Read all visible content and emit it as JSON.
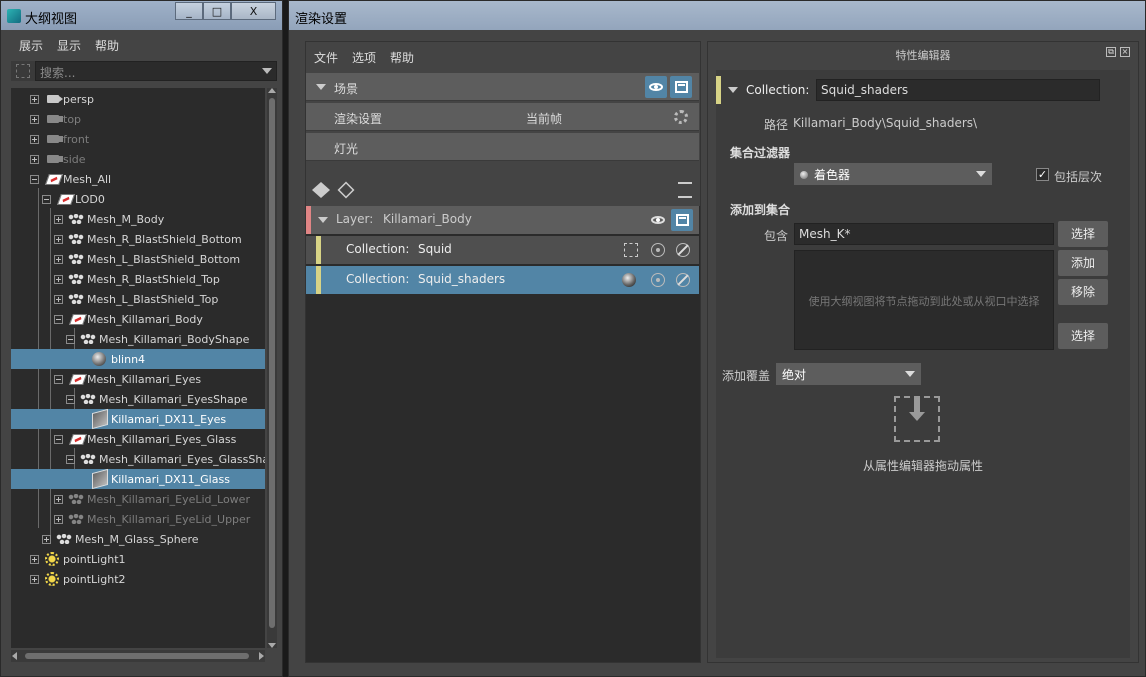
{
  "outliner": {
    "title": "大纲视图",
    "window_buttons": [
      "_",
      "□",
      "X"
    ],
    "menu": [
      "展示",
      "显示",
      "帮助"
    ],
    "search_placeholder": "搜索...",
    "rows": [
      {
        "label": "persp",
        "icon": "camera-icon",
        "dim": false
      },
      {
        "label": "top",
        "icon": "camera-icon",
        "dim": true
      },
      {
        "label": "front",
        "icon": "camera-icon",
        "dim": true
      },
      {
        "label": "side",
        "icon": "camera-icon",
        "dim": true
      },
      {
        "label": "Mesh_All",
        "icon": "group-icon",
        "dim": false
      },
      {
        "label": "LOD0",
        "icon": "group-icon",
        "dim": false
      },
      {
        "label": "Mesh_M_Body",
        "icon": "mesh-icon",
        "dim": false
      },
      {
        "label": "Mesh_R_BlastShield_Bottom",
        "icon": "mesh-icon",
        "dim": false
      },
      {
        "label": "Mesh_L_BlastShield_Bottom",
        "icon": "mesh-icon",
        "dim": false
      },
      {
        "label": "Mesh_R_BlastShield_Top",
        "icon": "mesh-icon",
        "dim": false
      },
      {
        "label": "Mesh_L_BlastShield_Top",
        "icon": "mesh-icon",
        "dim": false
      },
      {
        "label": "Mesh_Killamari_Body",
        "icon": "group-icon",
        "dim": false
      },
      {
        "label": "Mesh_Killamari_BodyShape",
        "icon": "mesh-icon",
        "dim": false
      },
      {
        "label": "blinn4",
        "icon": "material-ball-icon",
        "dim": false,
        "selected": true
      },
      {
        "label": "Mesh_Killamari_Eyes",
        "icon": "group-icon",
        "dim": false
      },
      {
        "label": "Mesh_Killamari_EyesShape",
        "icon": "mesh-icon",
        "dim": false
      },
      {
        "label": "Killamari_DX11_Eyes",
        "icon": "shading-group-icon",
        "dim": false,
        "selected": true
      },
      {
        "label": "Mesh_Killamari_Eyes_Glass",
        "icon": "group-icon",
        "dim": false
      },
      {
        "label": "Mesh_Killamari_Eyes_GlassShape",
        "icon": "mesh-icon",
        "dim": false
      },
      {
        "label": "Killamari_DX11_Glass",
        "icon": "shading-group-icon",
        "dim": false,
        "selected": true
      },
      {
        "label": "Mesh_Killamari_EyeLid_Lower",
        "icon": "mesh-icon",
        "dim": true
      },
      {
        "label": "Mesh_Killamari_EyeLid_Upper",
        "icon": "mesh-icon",
        "dim": true
      },
      {
        "label": "Mesh_M_Glass_Sphere",
        "icon": "mesh-icon",
        "dim": false
      },
      {
        "label": "pointLight1",
        "icon": "point-light-icon",
        "dim": false
      },
      {
        "label": "pointLight2",
        "icon": "point-light-icon",
        "dim": false
      }
    ]
  },
  "render_setup": {
    "title": "渲染设置",
    "menu": [
      "文件",
      "选项",
      "帮助"
    ],
    "scene_label": "场景",
    "render_settings_label": "渲染设置",
    "current_frame_label": "当前帧",
    "lights_label": "灯光",
    "layer_label": "Layer:",
    "layer_name": "Killamari_Body",
    "collections": [
      {
        "prefix": "Collection:",
        "name": "Squid",
        "selected": false
      },
      {
        "prefix": "Collection:",
        "name": "Squid_shaders",
        "selected": true
      }
    ]
  },
  "attribute_editor": {
    "title": "特性编辑器",
    "collection_label": "Collection:",
    "collection_name": "Squid_shaders",
    "path_label": "路径",
    "path_value": "Killamari_Body\\Squid_shaders\\",
    "filter_header": "集合过滤器",
    "filter_value": "着色器",
    "include_hierarchy_label": "包括层次",
    "include_hierarchy_checked": true,
    "add_to_collection_header": "添加到集合",
    "include_label": "包含",
    "include_value": "Mesh_K*",
    "select_button": "选择",
    "add_button": "添加",
    "remove_button": "移除",
    "select_button_2": "选择",
    "dropzone_hint": "使用大纲视图将节点拖动到此处或从视口中选择",
    "add_override_label": "添加覆盖",
    "override_value": "绝对",
    "drag_hint": "从属性编辑器拖动属性"
  },
  "colors": {
    "selection": "#5285a6",
    "layer_accent": "#e08585",
    "collection_accent": "#d7d386",
    "titlebar": "#9fb1c8"
  }
}
